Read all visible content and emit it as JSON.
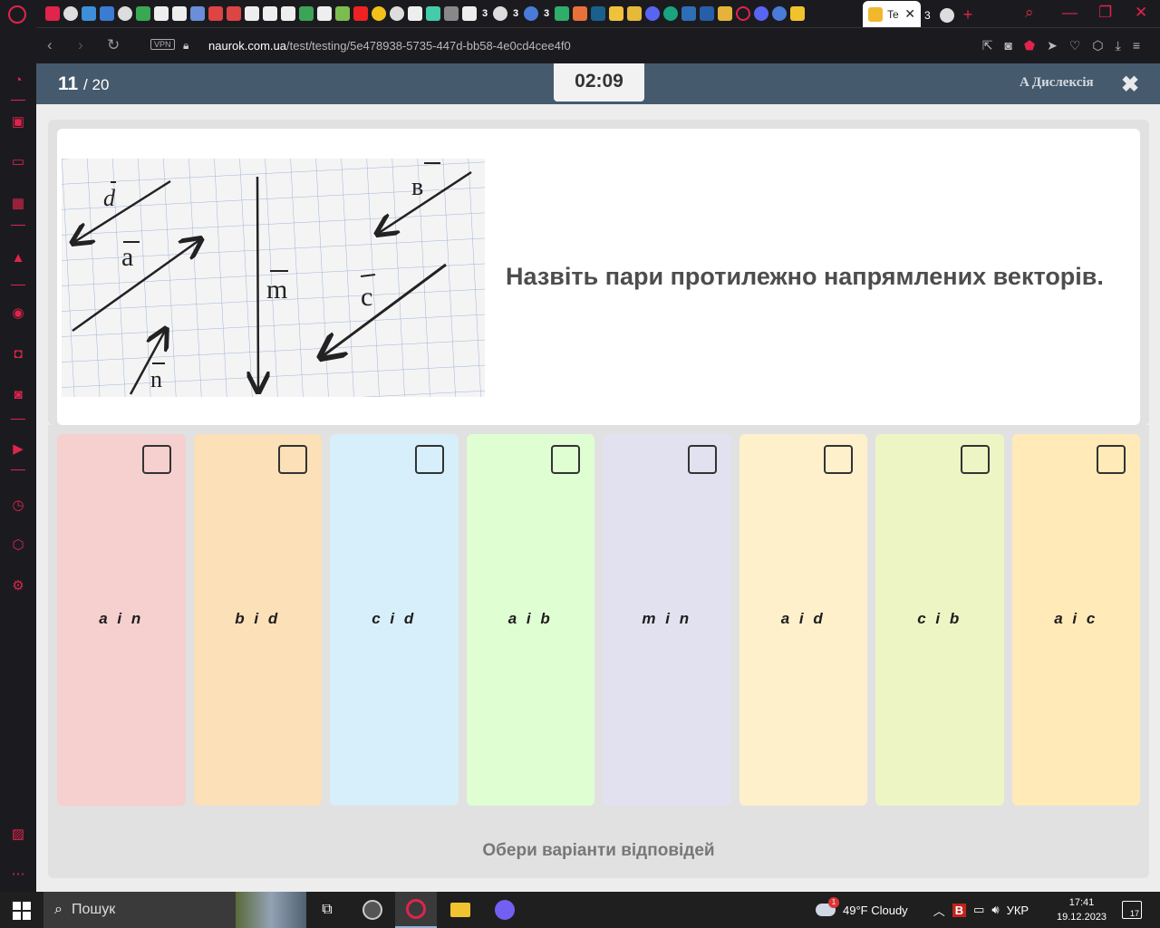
{
  "browser": {
    "url_domain": "naurok.com.ua",
    "url_path": "/test/testing/5e478938-5735-447d-bb58-4e0cd4cee4f0",
    "vpn_label": "VPN",
    "active_tab_label": "Te",
    "tab_numbers": [
      "3",
      "3",
      "3",
      "3"
    ]
  },
  "quiz": {
    "current": "11",
    "total": "/ 20",
    "timer": "02:09",
    "dyslexia_label": "A Дислексія",
    "question": "Назвіть пари протилежно напрямлених векторів.",
    "image_labels": {
      "d": "d",
      "a": "a",
      "n": "n",
      "m": "m",
      "b": "в",
      "c": "c"
    },
    "answers": [
      {
        "label": "a i n",
        "color": "#f6cfcf"
      },
      {
        "label": "b i d",
        "color": "#fbe0b8"
      },
      {
        "label": "c i d",
        "color": "#d6effa"
      },
      {
        "label": "a i b",
        "color": "#dfffd3"
      },
      {
        "label": "m i n",
        "color": "#e2e1ef"
      },
      {
        "label": "a i d",
        "color": "#fdf0cb"
      },
      {
        "label": "c i b",
        "color": "#eef5c4"
      },
      {
        "label": "a i c",
        "color": "#ffeab8"
      }
    ],
    "footer": "Обери варіанти відповідей"
  },
  "taskbar": {
    "search_placeholder": "Пошук",
    "weather": "49°F  Cloudy",
    "weather_badge": "1",
    "lang": "УКР",
    "time": "17:41",
    "date": "19.12.2023",
    "notifications": "17"
  },
  "colors": {
    "header": "#455a6d",
    "brand_red": "#e0244c"
  }
}
